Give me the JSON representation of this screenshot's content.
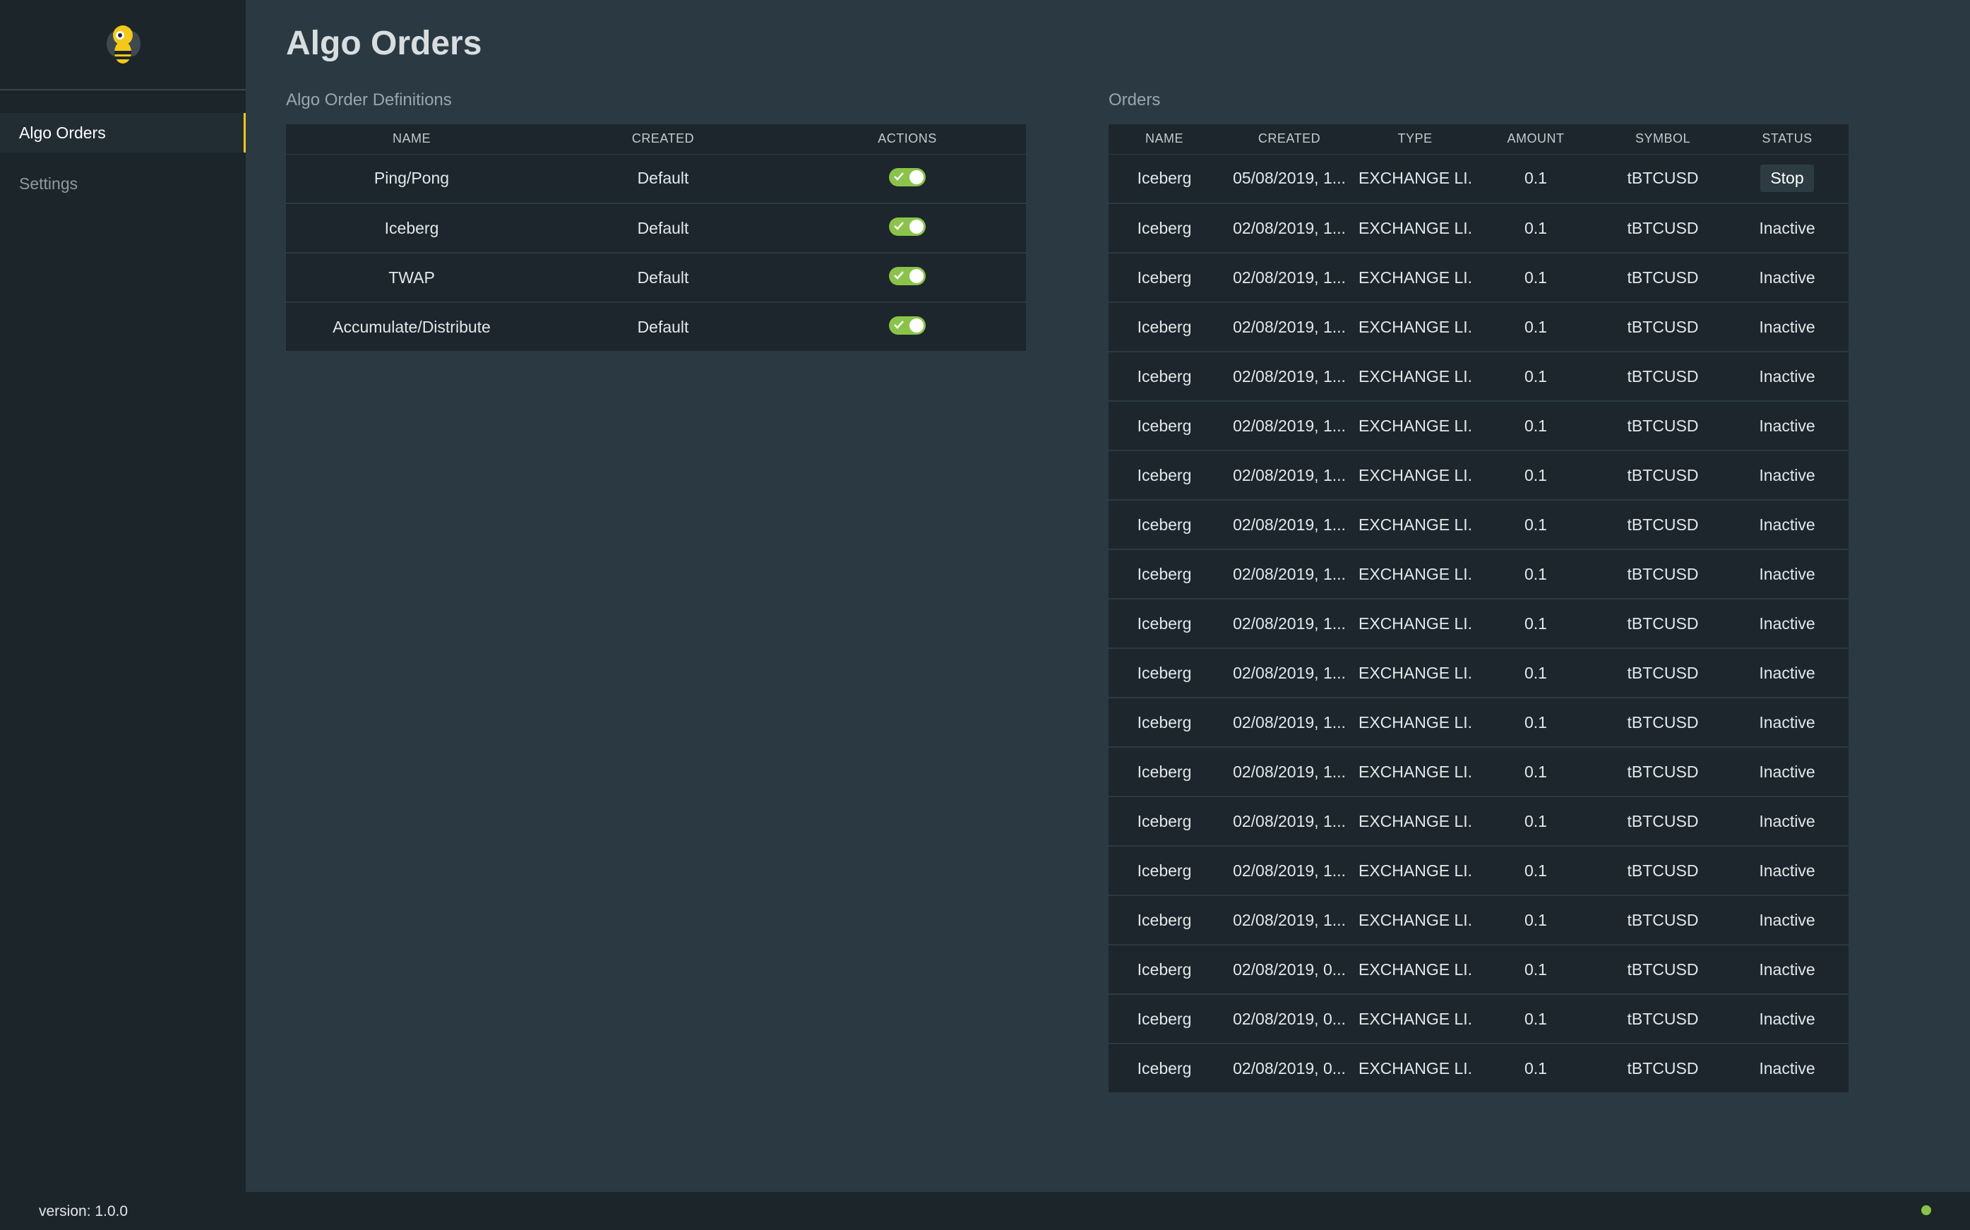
{
  "sidebar": {
    "nav": [
      {
        "label": "Algo Orders",
        "active": true
      },
      {
        "label": "Settings",
        "active": false
      }
    ],
    "version": "version: 1.0.0"
  },
  "page": {
    "title": "Algo Orders"
  },
  "definitions": {
    "title": "Algo Order Definitions",
    "columns": [
      "NAME",
      "CREATED",
      "ACTIONS"
    ],
    "rows": [
      {
        "name": "Ping/Pong",
        "created": "Default",
        "enabled": true
      },
      {
        "name": "Iceberg",
        "created": "Default",
        "enabled": true
      },
      {
        "name": "TWAP",
        "created": "Default",
        "enabled": true
      },
      {
        "name": "Accumulate/Distribute",
        "created": "Default",
        "enabled": true
      }
    ]
  },
  "orders": {
    "title": "Orders",
    "columns": [
      "NAME",
      "CREATED",
      "TYPE",
      "AMOUNT",
      "SYMBOL",
      "STATUS"
    ],
    "rows": [
      {
        "name": "Iceberg",
        "created": "05/08/2019, 1...",
        "type": "EXCHANGE LI...",
        "amount": "0.1",
        "symbol": "tBTCUSD",
        "status": "Stop"
      },
      {
        "name": "Iceberg",
        "created": "02/08/2019, 1...",
        "type": "EXCHANGE LI...",
        "amount": "0.1",
        "symbol": "tBTCUSD",
        "status": "Inactive"
      },
      {
        "name": "Iceberg",
        "created": "02/08/2019, 1...",
        "type": "EXCHANGE LI...",
        "amount": "0.1",
        "symbol": "tBTCUSD",
        "status": "Inactive"
      },
      {
        "name": "Iceberg",
        "created": "02/08/2019, 1...",
        "type": "EXCHANGE LI...",
        "amount": "0.1",
        "symbol": "tBTCUSD",
        "status": "Inactive"
      },
      {
        "name": "Iceberg",
        "created": "02/08/2019, 1...",
        "type": "EXCHANGE LI...",
        "amount": "0.1",
        "symbol": "tBTCUSD",
        "status": "Inactive"
      },
      {
        "name": "Iceberg",
        "created": "02/08/2019, 1...",
        "type": "EXCHANGE LI...",
        "amount": "0.1",
        "symbol": "tBTCUSD",
        "status": "Inactive"
      },
      {
        "name": "Iceberg",
        "created": "02/08/2019, 1...",
        "type": "EXCHANGE LI...",
        "amount": "0.1",
        "symbol": "tBTCUSD",
        "status": "Inactive"
      },
      {
        "name": "Iceberg",
        "created": "02/08/2019, 1...",
        "type": "EXCHANGE LI...",
        "amount": "0.1",
        "symbol": "tBTCUSD",
        "status": "Inactive"
      },
      {
        "name": "Iceberg",
        "created": "02/08/2019, 1...",
        "type": "EXCHANGE LI...",
        "amount": "0.1",
        "symbol": "tBTCUSD",
        "status": "Inactive"
      },
      {
        "name": "Iceberg",
        "created": "02/08/2019, 1...",
        "type": "EXCHANGE LI...",
        "amount": "0.1",
        "symbol": "tBTCUSD",
        "status": "Inactive"
      },
      {
        "name": "Iceberg",
        "created": "02/08/2019, 1...",
        "type": "EXCHANGE LI...",
        "amount": "0.1",
        "symbol": "tBTCUSD",
        "status": "Inactive"
      },
      {
        "name": "Iceberg",
        "created": "02/08/2019, 1...",
        "type": "EXCHANGE LI...",
        "amount": "0.1",
        "symbol": "tBTCUSD",
        "status": "Inactive"
      },
      {
        "name": "Iceberg",
        "created": "02/08/2019, 1...",
        "type": "EXCHANGE LI...",
        "amount": "0.1",
        "symbol": "tBTCUSD",
        "status": "Inactive"
      },
      {
        "name": "Iceberg",
        "created": "02/08/2019, 1...",
        "type": "EXCHANGE LI...",
        "amount": "0.1",
        "symbol": "tBTCUSD",
        "status": "Inactive"
      },
      {
        "name": "Iceberg",
        "created": "02/08/2019, 1...",
        "type": "EXCHANGE LI...",
        "amount": "0.1",
        "symbol": "tBTCUSD",
        "status": "Inactive"
      },
      {
        "name": "Iceberg",
        "created": "02/08/2019, 1...",
        "type": "EXCHANGE LI...",
        "amount": "0.1",
        "symbol": "tBTCUSD",
        "status": "Inactive"
      },
      {
        "name": "Iceberg",
        "created": "02/08/2019, 0...",
        "type": "EXCHANGE LI...",
        "amount": "0.1",
        "symbol": "tBTCUSD",
        "status": "Inactive"
      },
      {
        "name": "Iceberg",
        "created": "02/08/2019, 0...",
        "type": "EXCHANGE LI...",
        "amount": "0.1",
        "symbol": "tBTCUSD",
        "status": "Inactive"
      },
      {
        "name": "Iceberg",
        "created": "02/08/2019, 0...",
        "type": "EXCHANGE LI...",
        "amount": "0.1",
        "symbol": "tBTCUSD",
        "status": "Inactive"
      }
    ]
  },
  "colors": {
    "accent": "#f3c81a",
    "toggle_on": "#8bc34a",
    "connection_ok": "#8bc34a"
  },
  "icons": {
    "logo": "bee-logo-icon",
    "toggle": "toggle-switch-icon",
    "connection": "connection-status-dot"
  }
}
